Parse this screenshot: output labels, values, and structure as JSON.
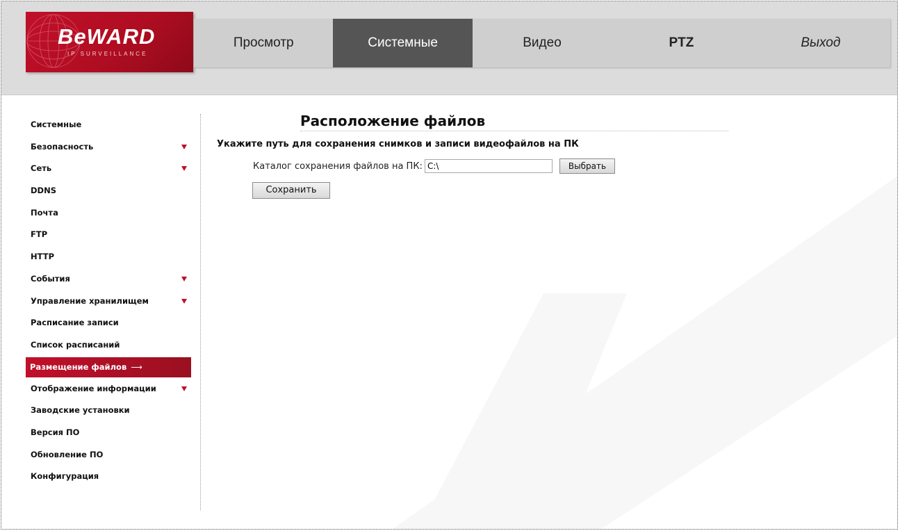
{
  "brand": {
    "name": "BeWARD",
    "tagline": "IP SURVEILLANCE",
    "primary_color": "#c0102a"
  },
  "nav": {
    "items": [
      {
        "label": "Просмотр"
      },
      {
        "label": "Системные",
        "active": true
      },
      {
        "label": "Видео"
      },
      {
        "label": "PTZ"
      },
      {
        "label": "Выход"
      }
    ]
  },
  "sidebar": {
    "items": [
      {
        "label": "Системные"
      },
      {
        "label": "Безопасность",
        "has_submenu": true
      },
      {
        "label": "Сеть",
        "has_submenu": true
      },
      {
        "label": "DDNS"
      },
      {
        "label": "Почта"
      },
      {
        "label": "FTP"
      },
      {
        "label": "HTTP"
      },
      {
        "label": "События",
        "has_submenu": true
      },
      {
        "label": "Управление хранилищем",
        "has_submenu": true
      },
      {
        "label": "Расписание записи"
      },
      {
        "label": "Список расписаний"
      },
      {
        "label": "Размещение файлов",
        "active": true,
        "suffix": "⟶"
      },
      {
        "label": "Отображение информации",
        "has_submenu": true
      },
      {
        "label": "Заводские установки"
      },
      {
        "label": "Версия ПО"
      },
      {
        "label": "Обновление ПО"
      },
      {
        "label": "Конфигурация"
      }
    ]
  },
  "main": {
    "title": "Расположение файлов",
    "description": "Укажите путь для сохранения снимков и записи видеофайлов на ПК",
    "path_label": "Каталог сохранения файлов на ПК:",
    "path_value": "C:\\",
    "browse_label": "Выбрать",
    "save_label": "Сохранить"
  }
}
